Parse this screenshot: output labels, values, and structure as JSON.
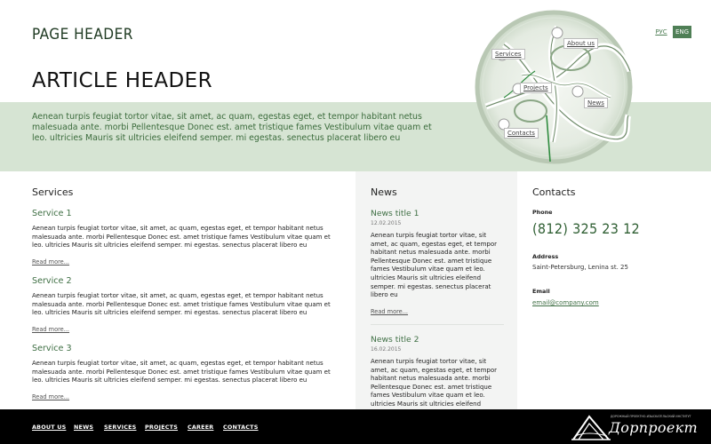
{
  "header": {
    "page_title": "PAGE HEADER",
    "article_title": "ARTICLE HEADER",
    "intro": "Aenean turpis feugiat tortor vitae, sit amet, ac quam, egestas eget, et tempor habitant netus malesuada ante. morbi Pellentesque Donec est. amet tristique fames Vestibulum vitae quam et leo. ultricies Mauris sit ultricies eleifend semper. mi egestas. senectus placerat libero eu",
    "lang_ru": "РУС",
    "lang_en": "ENG"
  },
  "map": {
    "links": [
      "About us",
      "Services",
      "Projects",
      "News",
      "Contacts"
    ]
  },
  "services": {
    "title": "Services",
    "items": [
      {
        "title": "Service 1",
        "text": "Aenean turpis feugiat tortor vitae, sit amet, ac quam, egestas eget, et tempor habitant netus malesuada ante. morbi Pellentesque Donec est. amet tristique fames Vestibulum vitae quam et leo. ultricies Mauris sit ultricies eleifend semper. mi egestas. senectus placerat libero eu",
        "more": "Read more..."
      },
      {
        "title": "Service 2",
        "text": "Aenean turpis feugiat tortor vitae, sit amet, ac quam, egestas eget, et tempor habitant netus malesuada ante. morbi Pellentesque Donec est. amet tristique fames Vestibulum vitae quam et leo. ultricies Mauris sit ultricies eleifend semper. mi egestas. senectus placerat libero eu",
        "more": "Read more..."
      },
      {
        "title": "Service 3",
        "text": "Aenean turpis feugiat tortor vitae, sit amet, ac quam, egestas eget, et tempor habitant netus malesuada ante. morbi Pellentesque Donec est. amet tristique fames Vestibulum vitae quam et leo. ultricies Mauris sit ultricies eleifend semper. mi egestas. senectus placerat libero eu",
        "more": "Read more..."
      }
    ]
  },
  "news": {
    "title": "News",
    "items": [
      {
        "title": "News title 1",
        "date": "12.02.2015",
        "text": "Aenean turpis feugiat tortor vitae, sit amet, ac quam, egestas eget, et tempor habitant netus malesuada ante. morbi Pellentesque Donec est. amet tristique fames Vestibulum vitae quam et leo. ultricies Mauris sit ultricies eleifend semper. mi egestas. senectus placerat libero eu",
        "more": "Read more..."
      },
      {
        "title": "News title 2",
        "date": "16.02.2015",
        "text": "Aenean turpis feugiat tortor vitae, sit amet, ac quam, egestas eget, et tempor habitant netus malesuada ante. morbi Pellentesque Donec est. amet tristique fames Vestibulum vitae quam et leo. ultricies Mauris sit ultricies eleifend"
      }
    ]
  },
  "contacts": {
    "title": "Contacts",
    "phone_label": "Phone",
    "phone": "(812) 325 23 12",
    "address_label": "Address",
    "address": "Saint-Petersburg, Lenina st. 25",
    "email_label": "Email",
    "email": "email@company.com"
  },
  "footer": {
    "nav": [
      "ABOUT US",
      "NEWS",
      "SERVICES",
      "PROJECTS",
      "CAREER",
      "CONTACTS"
    ],
    "logo_text": "Дорпроект",
    "logo_subtext": "ДОРОЖНЫЙ ПРОЕКТНО-ИЗЫСКАТЕЛЬСКИЙ ИНСТИТУТ"
  },
  "colors": {
    "accent": "#4f7f56",
    "band": "#d6e4d3",
    "footer": "#000000"
  }
}
